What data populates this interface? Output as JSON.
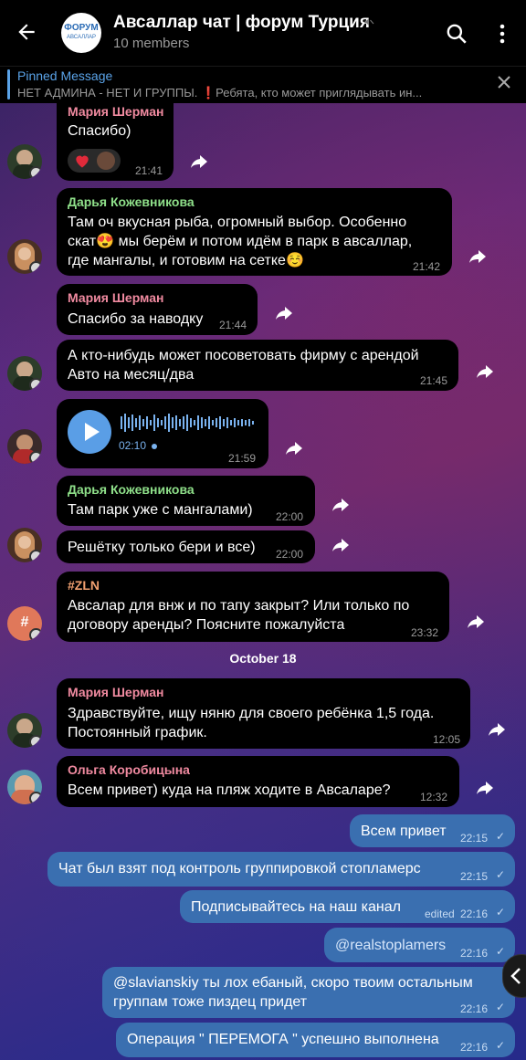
{
  "header": {
    "back_label": "←",
    "title": "Авсаллар чат | форум Турция",
    "subtitle": "10 members",
    "logo_top": "ФОРУМ",
    "logo_bottom": "АВСАЛЛАР"
  },
  "pinned": {
    "title": "Pinned Message",
    "text": "НЕТ АДМИНА - НЕТ И ГРУППЫ.  ❗Ребята, кто может приглядывать ин..."
  },
  "messages": [
    {
      "sender": "Мария Шерман",
      "text": [
        "Спасибо)"
      ],
      "time": "21:41"
    },
    {
      "sender": "Дарья Кожевникова",
      "text": [
        "Там оч вкусная рыба, огромный выбор. Особенно",
        "скат😍 мы берём и потом идём в парк в авсаллар,",
        "где мангалы, и готовим на сетке☺️"
      ],
      "time": "21:42"
    },
    {
      "sender": "Мария Шерман",
      "text": [
        "Спасибо за наводку"
      ],
      "time": "21:44"
    },
    {
      "sender": "",
      "text": [
        "А кто-нибудь может посоветовать фирму с арендой",
        "Авто на месяц/два"
      ],
      "time": "21:45"
    },
    {
      "sender": "",
      "text": [],
      "time": "21:59",
      "voice_duration": "02:10"
    },
    {
      "sender": "Дарья Кожевникова",
      "text": [
        "Там парк уже с мангалами)"
      ],
      "time": "22:00"
    },
    {
      "sender": "",
      "text": [
        "Решётку только бери и все)"
      ],
      "time": "22:00"
    },
    {
      "sender": "#ZLN",
      "text": [
        "Авсалар для внж и по тапу закрыт? Или только по",
        "договору аренды? Поясните пожалуйста"
      ],
      "time": "23:32"
    },
    {
      "sender": "Мария Шерман",
      "text": [
        "Здравствуйте, ищу няню для своего ребёнка 1,5 года.",
        "Постоянный график."
      ],
      "time": "12:05"
    },
    {
      "sender": "Ольга Коробицына",
      "text": [
        "Всем привет) куда на пляж ходите в Авсаларе?"
      ],
      "time": "12:32"
    }
  ],
  "date_separator": "October 18",
  "avatar_hash_label": "#",
  "outgoing": [
    {
      "text": [
        "Всем привет"
      ],
      "time": "22:15"
    },
    {
      "text": [
        "Чат был взят под контроль группировкой стопламерс"
      ],
      "time": "22:15"
    },
    {
      "text": [
        "Подписывайтесь на наш канал"
      ],
      "time": "22:16",
      "edited": "edited"
    },
    {
      "text": [
        "@realstoplamers"
      ],
      "time": "22:16"
    },
    {
      "text": [
        "@slavianskiy ты лох ебаный, скоро твоим остальным",
        "группам тоже пиздец придет"
      ],
      "time": "22:16"
    },
    {
      "text": [
        "Операция \" ПЕРЕМОГА \" успешно выполнена"
      ],
      "time": "22:16"
    }
  ],
  "colors": {
    "accent": "#5aa3e8",
    "outgoing_bubble": "#3a6fb0",
    "sender_pink": "#f08aa0",
    "sender_green": "#8fe08a",
    "sender_orange": "#f0a070",
    "sender_purple": "#f08aa0"
  },
  "icons": {
    "back": "arrow-left-icon",
    "search": "search-icon",
    "menu": "more-vertical-icon",
    "mute": "muted-speaker-icon",
    "close": "close-icon",
    "forward": "forward-arrow-icon",
    "play": "play-icon",
    "reaction": "heart-icon"
  }
}
